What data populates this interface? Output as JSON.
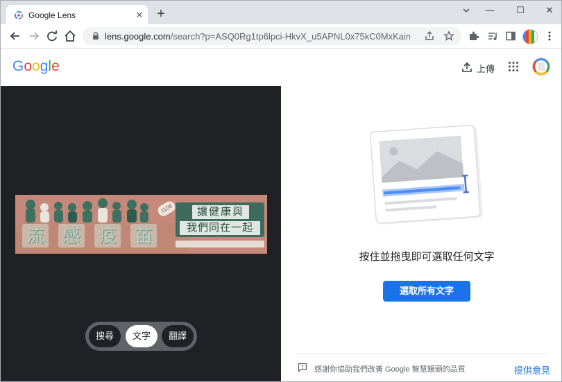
{
  "browser": {
    "tab_title": "Google Lens",
    "tab_close": "✕",
    "new_tab": "+",
    "window_controls": {
      "minimize": "—",
      "restore": "☐",
      "close": "✕"
    },
    "url_host": "lens.google.com",
    "url_path": "/search?p=ASQ0Rg1tp6lpci-HkvX_u5APNL0x75kC0MxKainsW..."
  },
  "lens": {
    "logo_letters": [
      {
        "char": "G",
        "color": "#4285F4"
      },
      {
        "char": "o",
        "color": "#EA4335"
      },
      {
        "char": "o",
        "color": "#FBBC05"
      },
      {
        "char": "g",
        "color": "#4285F4"
      },
      {
        "char": "l",
        "color": "#34A853"
      },
      {
        "char": "e",
        "color": "#EA4335"
      }
    ],
    "upload_label": "上傳",
    "image": {
      "big_chars": [
        "流",
        "感",
        "疫",
        "苗"
      ],
      "plate_line1": "讓健康與",
      "plate_line2": "我們同在一起",
      "tag": "1108"
    },
    "modes": [
      {
        "label": "搜尋",
        "active": false
      },
      {
        "label": "文字",
        "active": true
      },
      {
        "label": "翻譯",
        "active": false
      }
    ],
    "instruction": "按住並拖曳即可選取任何文字",
    "select_all_label": "選取所有文字",
    "feedback_text": "感謝你協助我們改善 Google 智慧鏡頭的品質",
    "feedback_link": "提供意見"
  },
  "colors": {
    "accent": "#1a73e8",
    "left_pane_bg": "#202124",
    "tabstrip_bg": "#dee1e6"
  }
}
